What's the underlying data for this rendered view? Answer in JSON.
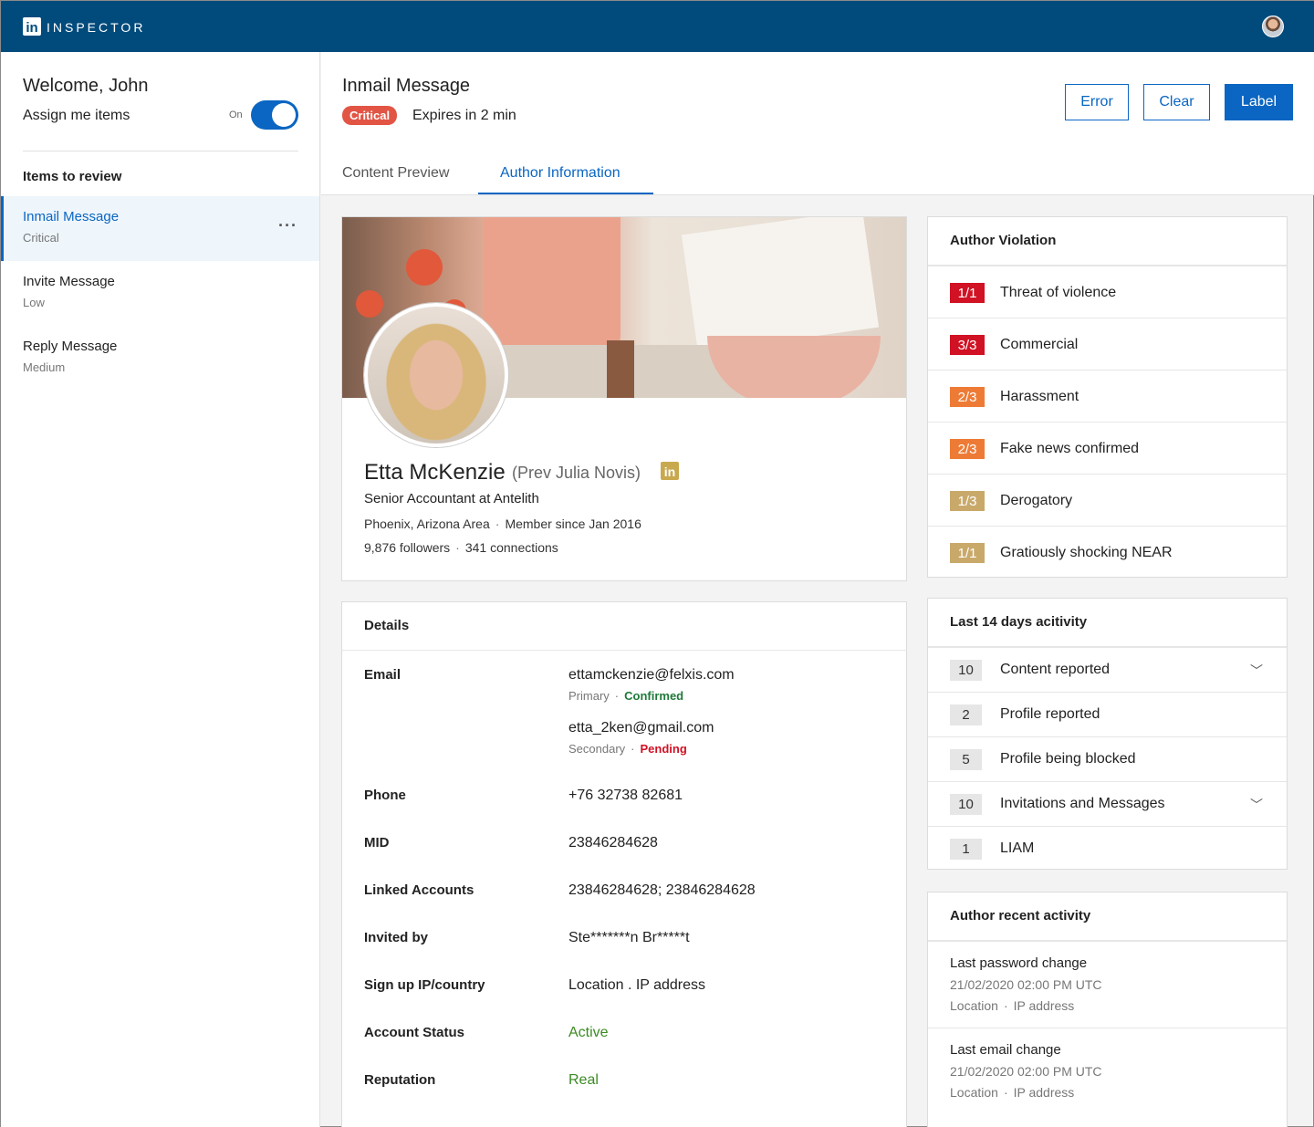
{
  "app": {
    "logo_mark": "in",
    "title": "INSPECTOR"
  },
  "sidebar": {
    "welcome": "Welcome, John",
    "assign_label": "Assign me items",
    "toggle_state": "On",
    "items_title": "Items to review",
    "items": [
      {
        "name": "Inmail Message",
        "severity": "Critical"
      },
      {
        "name": "Invite Message",
        "severity": "Low"
      },
      {
        "name": "Reply Message",
        "severity": "Medium"
      }
    ],
    "more": "···"
  },
  "header": {
    "title": "Inmail Message",
    "badge": "Critical",
    "expires": "Expires in 2 min",
    "buttons": {
      "error": "Error",
      "clear": "Clear",
      "label": "Label"
    },
    "tabs": [
      "Content Preview",
      "Author Information"
    ]
  },
  "profile": {
    "name": "Etta McKenzie",
    "prev_name": "(Prev Julia Novis)",
    "in_icon": "in",
    "title": "Senior Accountant at Antelith",
    "location": "Phoenix, Arizona Area",
    "member_since": "Member since Jan 2016",
    "followers": "9,876 followers",
    "connections": "341 connections",
    "separator": "·"
  },
  "details": {
    "title": "Details",
    "email_label": "Email",
    "email_primary": "ettamckenzie@felxis.com",
    "email_primary_type": "Primary",
    "email_primary_status": "Confirmed",
    "email_secondary": "etta_2ken@gmail.com",
    "email_secondary_type": "Secondary",
    "email_secondary_status": "Pending",
    "rows": [
      {
        "label": "Phone",
        "value": "+76 32738 82681"
      },
      {
        "label": "MID",
        "value": "23846284628"
      },
      {
        "label": "Linked Accounts",
        "value": "23846284628; 23846284628"
      },
      {
        "label": "Invited by",
        "value": "Ste*******n Br*****t"
      },
      {
        "label": "Sign up IP/country",
        "value": "Location . IP address"
      },
      {
        "label": "Account Status",
        "value": "Active"
      },
      {
        "label": "Reputation",
        "value": "Real"
      }
    ]
  },
  "violation": {
    "title": "Author Violation",
    "rows": [
      {
        "count": "1/1",
        "label": "Threat of violence",
        "color": "#d11124"
      },
      {
        "count": "3/3",
        "label": "Commercial",
        "color": "#d11124"
      },
      {
        "count": "2/3",
        "label": "Harassment",
        "color": "#ee7b35"
      },
      {
        "count": "2/3",
        "label": "Fake news confirmed",
        "color": "#ee7b35"
      },
      {
        "count": "1/3",
        "label": "Derogatory",
        "color": "#c9a96a"
      },
      {
        "count": "1/1",
        "label": "Gratiously shocking NEAR",
        "color": "#c9a96a"
      }
    ]
  },
  "activity": {
    "title": "Last 14 days acitivity",
    "rows": [
      {
        "count": "10",
        "label": "Content reported",
        "expandable": true
      },
      {
        "count": "2",
        "label": "Profile reported",
        "expandable": false
      },
      {
        "count": "5",
        "label": "Profile being blocked",
        "expandable": false
      },
      {
        "count": "10",
        "label": "Invitations and Messages",
        "expandable": true
      },
      {
        "count": "1",
        "label": "LIAM",
        "expandable": false
      }
    ],
    "chevron": "﹀"
  },
  "recent": {
    "title": "Author recent activity",
    "items": [
      {
        "title": "Last password change",
        "date": "21/02/2020 02:00 PM UTC",
        "location": "Location",
        "ip": "IP address"
      },
      {
        "title": "Last email change",
        "date": "21/02/2020 02:00 PM UTC",
        "location": "Location",
        "ip": "IP address"
      }
    ]
  },
  "colors": {
    "brand": "#004b7c",
    "accent": "#0a66c2",
    "critical": "#e25545"
  }
}
